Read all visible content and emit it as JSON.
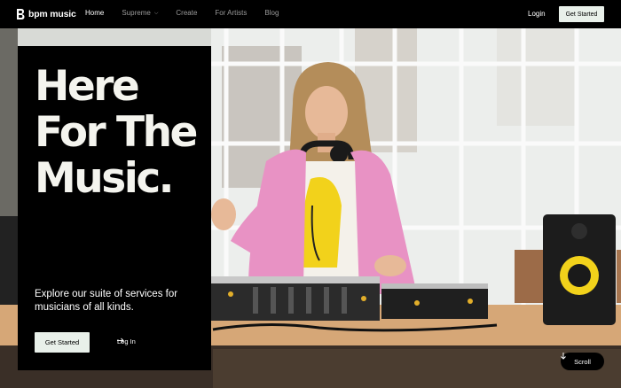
{
  "brand": {
    "name": "bpm music",
    "logo_icon": "bpm-b-logo-icon"
  },
  "nav": {
    "links": [
      {
        "label": "Home",
        "active": true
      },
      {
        "label": "Supreme",
        "dropdown": true
      },
      {
        "label": "Create"
      },
      {
        "label": "For Artists"
      },
      {
        "label": "Blog"
      }
    ],
    "login_label": "Login",
    "cta_label": "Get Started"
  },
  "hero": {
    "headline": [
      "Here",
      "For The",
      "Music."
    ],
    "subtitle": "Explore our suite of services for musicians of all kinds.",
    "primary_button": "Get Started",
    "secondary_button": "Log In",
    "scroll_label": "Scroll"
  },
  "colors": {
    "background": "#000000",
    "button_bg": "#e9f0ea",
    "headline": "#f4f4ee",
    "jacket_pink": "#e892c4",
    "speaker_yellow": "#f2d21b"
  }
}
